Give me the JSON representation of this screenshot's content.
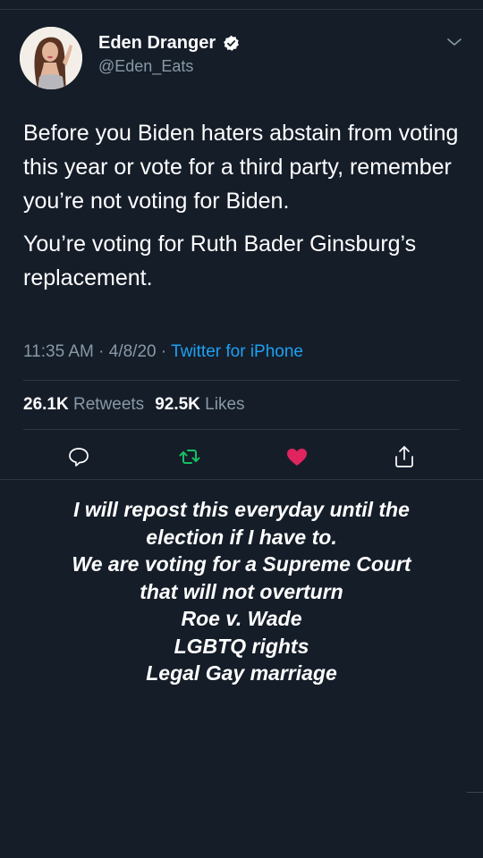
{
  "tweet": {
    "display_name": "Eden Dranger",
    "handle": "@Eden_Eats",
    "text_paragraphs": [
      "Before you Biden haters abstain from voting this year or vote for a third party, remember you’re not voting for Biden.",
      "You’re voting for Ruth Bader Ginsburg’s replacement."
    ],
    "time": "11:35 AM",
    "date": "4/8/20",
    "separator": "·",
    "source": "Twitter for iPhone",
    "retweets_count": "26.1K",
    "retweets_label": "Retweets",
    "likes_count": "92.5K",
    "likes_label": "Likes"
  },
  "icons": {
    "avatar": "profile-photo",
    "verified": "verified-badge-icon",
    "menu": "chevron-down-icon",
    "reply": "reply-icon",
    "retweet": "retweet-icon",
    "like": "heart-icon",
    "share": "share-icon"
  },
  "colors": {
    "background": "#151d29",
    "link": "#1da1f2",
    "retweet_active": "#17bf63",
    "like_active": "#e0245e",
    "muted": "#8899a6"
  },
  "caption": {
    "lines": [
      "I will repost this everyday until the",
      "election if I have to.",
      "We are voting for a Supreme Court",
      "that will not overturn",
      "Roe v. Wade",
      "LGBTQ rights",
      "Legal Gay marriage"
    ]
  }
}
